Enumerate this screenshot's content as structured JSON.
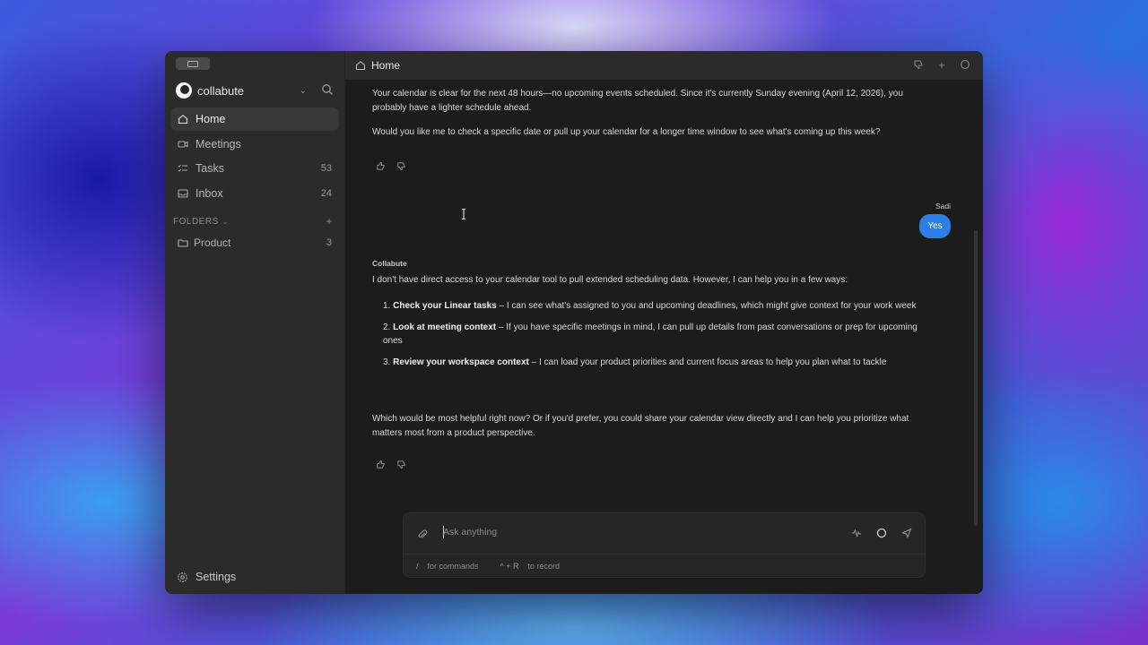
{
  "sidebar": {
    "workspace_name": "collabute",
    "nav": [
      {
        "label": "Home",
        "count": "",
        "icon": "home-icon",
        "active": true
      },
      {
        "label": "Meetings",
        "count": "",
        "icon": "video-icon"
      },
      {
        "label": "Tasks",
        "count": "53",
        "icon": "checklist-icon"
      },
      {
        "label": "Inbox",
        "count": "24",
        "icon": "inbox-icon"
      }
    ],
    "folders_header": "FOLDERS",
    "folders": [
      {
        "label": "Product",
        "count": "3"
      }
    ],
    "settings_label": "Settings"
  },
  "topbar": {
    "title": "Home"
  },
  "chat": {
    "msg1_p1": "Your calendar is clear for the next 48 hours—no upcoming events scheduled. Since it's currently Sunday evening (April 12, 2026), you probably have a lighter schedule ahead.",
    "msg1_p2": "Would you like me to check a specific date or pull up your calendar for a longer time window to see what's coming up this week?",
    "user_name": "Sadi",
    "user_message": "Yes",
    "assistant_name": "Collabute",
    "msg2_intro": "I don't have direct access to your calendar tool to pull extended scheduling data. However, I can help you in a few ways:",
    "list": [
      {
        "num": "1.",
        "bold": "Check your Linear tasks",
        "text": " – I can see what's assigned to you and upcoming deadlines, which might give context for your work week"
      },
      {
        "num": "2.",
        "bold": "Look at meeting context",
        "text": " – If you have specific meetings in mind, I can pull up details from past conversations or prep for upcoming ones"
      },
      {
        "num": "3.",
        "bold": "Review your workspace context",
        "text": " – I can load your product priorities and current focus areas to help you plan what to tackle"
      }
    ],
    "msg2_outro": "Which would be most helpful right now? Or if you'd prefer, you could share your calendar view directly and I can help you prioritize what matters most from a product perspective."
  },
  "composer": {
    "placeholder": "Ask anything",
    "hint1_key": "/",
    "hint1_text": "for commands",
    "hint2_key": "^ + R",
    "hint2_text": "to record"
  },
  "colors": {
    "accent": "#2d7fe8"
  }
}
